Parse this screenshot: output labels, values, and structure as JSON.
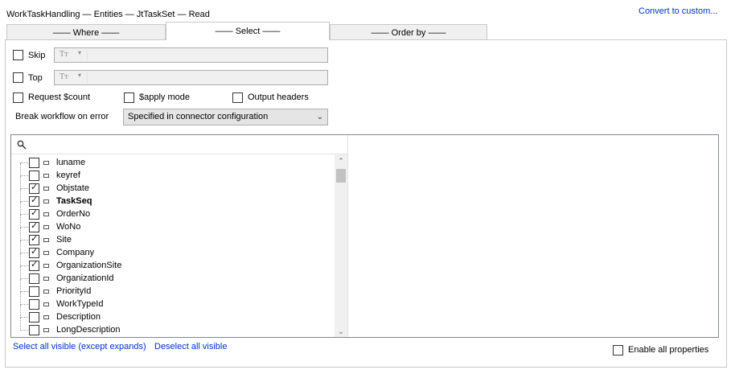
{
  "header": {
    "title": "WorkTaskHandling — Entities — JtTaskSet — Read",
    "convert_link": "Convert to custom..."
  },
  "tabs": [
    {
      "label": "—— Where ——",
      "active": false
    },
    {
      "label": "—— Select ——",
      "active": true
    },
    {
      "label": "—— Order by ——",
      "active": false
    }
  ],
  "options": {
    "skip": {
      "label": "Skip",
      "checked": false,
      "type_glyph": "Tт",
      "value": ""
    },
    "top": {
      "label": "Top",
      "checked": false,
      "type_glyph": "Tт",
      "value": ""
    },
    "request_count": {
      "label": "Request $count",
      "checked": false
    },
    "sapply_mode": {
      "label": "$apply mode",
      "checked": false
    },
    "output_headers": {
      "label": "Output headers",
      "checked": false
    },
    "break_workflow": {
      "label": "Break workflow on error",
      "selected": "Specified in connector configuration"
    }
  },
  "tree": {
    "search_placeholder": "",
    "items": [
      {
        "label": "luname",
        "checked": false,
        "bold": false
      },
      {
        "label": "keyref",
        "checked": false,
        "bold": false
      },
      {
        "label": "Objstate",
        "checked": true,
        "bold": false
      },
      {
        "label": "TaskSeq",
        "checked": true,
        "bold": true
      },
      {
        "label": "OrderNo",
        "checked": true,
        "bold": false
      },
      {
        "label": "WoNo",
        "checked": true,
        "bold": false
      },
      {
        "label": "Site",
        "checked": true,
        "bold": false
      },
      {
        "label": "Company",
        "checked": true,
        "bold": false
      },
      {
        "label": "OrganizationSite",
        "checked": true,
        "bold": false
      },
      {
        "label": "OrganizationId",
        "checked": false,
        "bold": false
      },
      {
        "label": "PriorityId",
        "checked": false,
        "bold": false
      },
      {
        "label": "WorkTypeId",
        "checked": false,
        "bold": false
      },
      {
        "label": "Description",
        "checked": false,
        "bold": false
      },
      {
        "label": "LongDescription",
        "checked": false,
        "bold": false
      }
    ]
  },
  "footer": {
    "select_all": "Select all visible (except expands)",
    "deselect_all": "Deselect all visible",
    "enable_all": {
      "label": "Enable all properties",
      "checked": false
    }
  }
}
